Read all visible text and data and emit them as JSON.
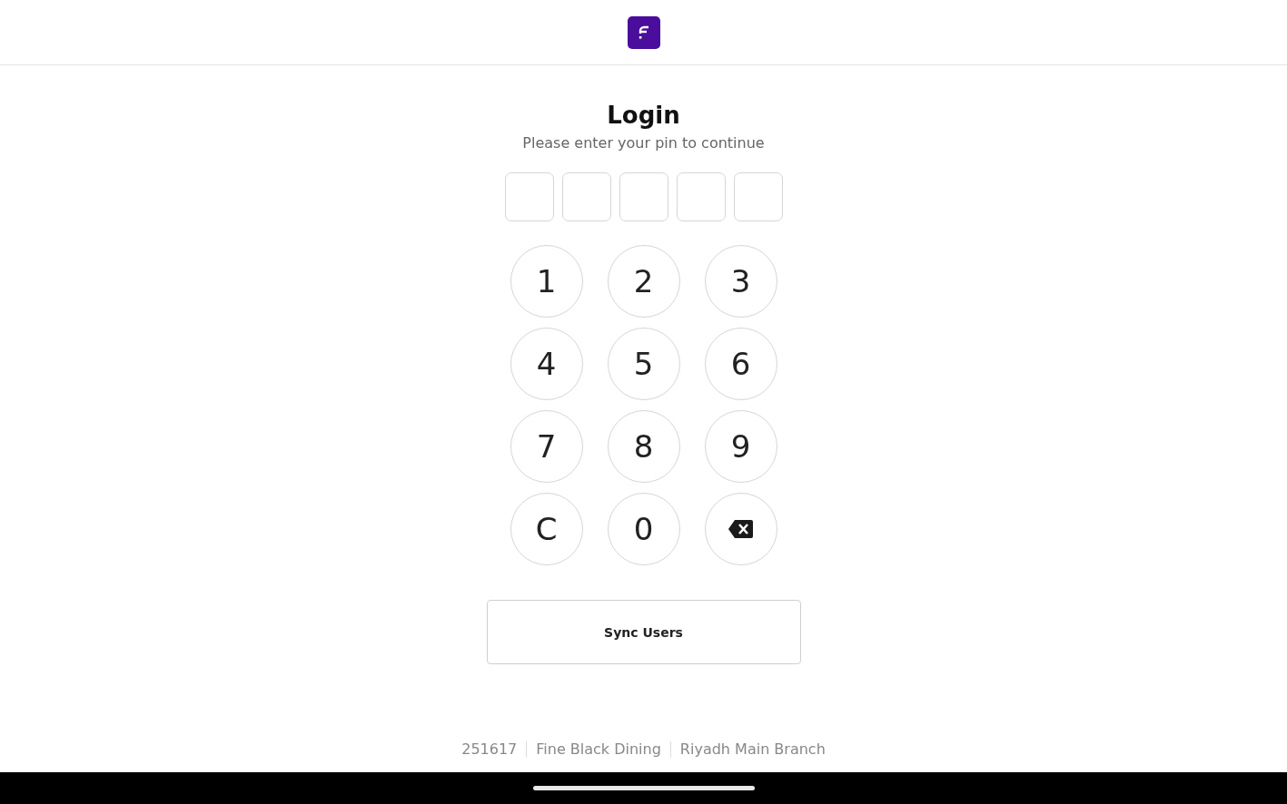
{
  "title": "Login",
  "subtitle": "Please enter your pin to continue",
  "pin_boxes": [
    {
      "filled": false
    },
    {
      "filled": false
    },
    {
      "filled": false
    },
    {
      "filled": false
    },
    {
      "filled": false
    }
  ],
  "keypad": [
    {
      "kind": "key",
      "label": "1"
    },
    {
      "kind": "key",
      "label": "2"
    },
    {
      "kind": "key",
      "label": "3"
    },
    {
      "kind": "key",
      "label": "4"
    },
    {
      "kind": "key",
      "label": "5"
    },
    {
      "kind": "key",
      "label": "6"
    },
    {
      "kind": "key",
      "label": "7"
    },
    {
      "kind": "key",
      "label": "8"
    },
    {
      "kind": "key",
      "label": "9"
    },
    {
      "kind": "key",
      "label": "C"
    },
    {
      "kind": "key",
      "label": "0"
    },
    {
      "kind": "backspace"
    }
  ],
  "sync_button": "Sync Users",
  "footer": [
    "251617",
    "Fine Black Dining",
    "Riyadh Main Branch"
  ]
}
